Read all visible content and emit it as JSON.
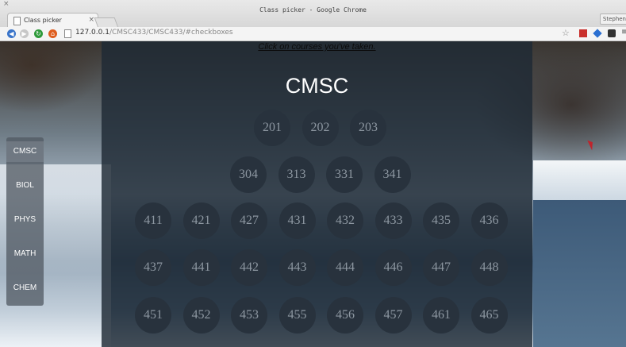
{
  "window": {
    "title": "Class picker - Google Chrome",
    "user_badge": "Stephen"
  },
  "tab": {
    "title": "Class picker",
    "close": "×"
  },
  "toolbar": {
    "url_host": "127.0.0.1",
    "url_path": "/CMSC433/CMSC433/#checkboxes"
  },
  "page": {
    "instruction": "Click on courses you've taken.",
    "department": "CMSC",
    "sidebar": [
      "CMSC",
      "BIOL",
      "PHYS",
      "MATH",
      "CHEM"
    ],
    "sidebar_active": "CMSC",
    "course_rows": [
      [
        "201",
        "202",
        "203"
      ],
      [
        "304",
        "313",
        "331",
        "341"
      ],
      [
        "411",
        "421",
        "427",
        "431",
        "432",
        "433",
        "435",
        "436"
      ],
      [
        "437",
        "441",
        "442",
        "443",
        "444",
        "446",
        "447",
        "448"
      ],
      [
        "451",
        "452",
        "453",
        "455",
        "456",
        "457",
        "461",
        "465"
      ]
    ]
  },
  "colors": {
    "panel": "#1f2934",
    "course_circle": "#28323d",
    "course_text": "#8d97a1"
  }
}
